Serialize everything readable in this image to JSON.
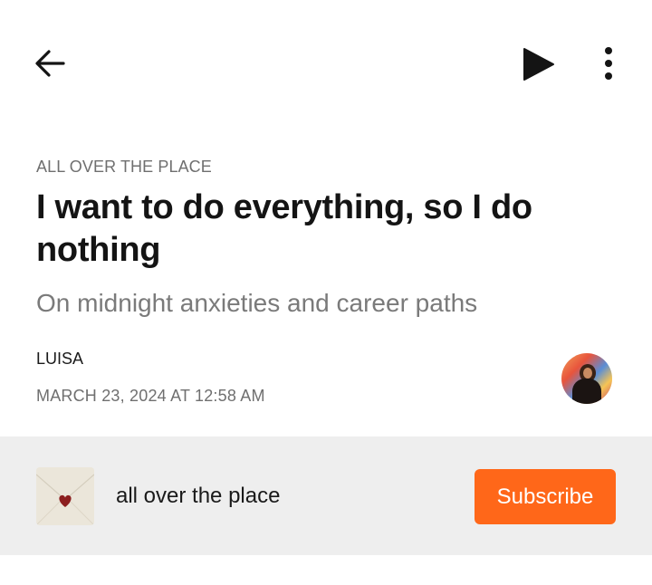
{
  "topbar": {
    "back_icon": "arrow-left-icon",
    "play_icon": "play-icon",
    "more_icon": "more-vertical-icon"
  },
  "article": {
    "section": "ALL OVER THE PLACE",
    "title": "I want to do everything, so I do nothing",
    "subtitle": "On midnight anxieties and career paths",
    "author": "LUISA",
    "date": "MARCH 23, 2024 AT 12:58 AM"
  },
  "publication": {
    "name": "all over the place",
    "subscribe_label": "Subscribe",
    "logo_icon": "envelope-heart-icon"
  },
  "colors": {
    "accent": "#ff6719",
    "title": "#141414",
    "muted": "#6f6f6f",
    "pub_bar": "#eeeeee"
  }
}
